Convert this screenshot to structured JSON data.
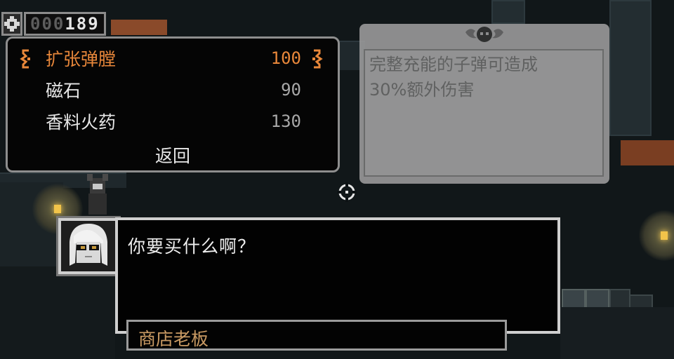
{
  "hud": {
    "currency_icon": "gear-currency-icon",
    "counter_dim": "000",
    "counter_lit": "189"
  },
  "shop": {
    "items": [
      {
        "name": "扩张弹膛",
        "price": "100",
        "selected": true
      },
      {
        "name": "磁石",
        "price": "90",
        "selected": false
      },
      {
        "name": "香料火药",
        "price": "130",
        "selected": false
      }
    ],
    "back_label": "返回",
    "selector_icon": "ornate-bracket-icon"
  },
  "description": {
    "line1": "完整充能的子弹可造成",
    "line2": "30%额外伤害",
    "emblem_icon": "winged-skull-emblem-icon"
  },
  "dialog": {
    "text": "你要买什么啊？",
    "speaker": "商店老板",
    "portrait_icon": "shopkeeper-portrait-icon"
  },
  "crosshair_icon": "crosshair-icon",
  "colors": {
    "accent": "#e8873a",
    "speaker": "#c99a63",
    "panel": "#9d9d9d"
  }
}
